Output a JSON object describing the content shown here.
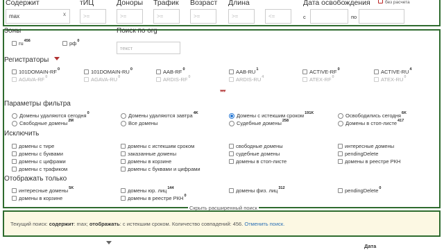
{
  "filters": {
    "content_label": "Содержит",
    "content_value": "max",
    "content_clear": "x",
    "tic_label": "тИЦ",
    "tic_placeholder": ">=",
    "donors_label": "Доноры",
    "donors_placeholder": ">=",
    "traffic_label": "Трафик",
    "traffic_placeholder": ">=",
    "age_label": "Возраст",
    "age_placeholder": ">=",
    "length_label": "Длина",
    "length_min_placeholder": ">=",
    "length_max_placeholder": "<=",
    "release_label": "Дата освобождения",
    "release_from": "с",
    "release_to": "по",
    "no_calc_label": "без расчета"
  },
  "zones": {
    "title": "Зоны",
    "items": [
      {
        "label": "ru",
        "count": "456"
      },
      {
        "label": "рф",
        "count": "0"
      }
    ]
  },
  "org_search": {
    "title": "Поиск по org",
    "placeholder": "текст"
  },
  "registrars": {
    "title": "Регистраторы",
    "items": [
      {
        "label": "101DOMAIN-RF",
        "count": "0"
      },
      {
        "label": "101DOMAIN-RU",
        "count": "0"
      },
      {
        "label": "AAB-RF",
        "count": "0"
      },
      {
        "label": "AAB-RU",
        "count": "1"
      },
      {
        "label": "ACTIVE-RF",
        "count": "0"
      },
      {
        "label": "ACTIVE-RU",
        "count": "4"
      },
      {
        "label": "AGAVA-RF",
        "count": "0"
      },
      {
        "label": "AGAVA-RU",
        "count": "0"
      },
      {
        "label": "ARDIS-RF",
        "count": "0"
      },
      {
        "label": "ARDIS-RU",
        "count": "4"
      },
      {
        "label": "ATEX-RF",
        "count": "0"
      },
      {
        "label": "ATEX-RU",
        "count": "0"
      }
    ],
    "more": "▾▾▾"
  },
  "filter_params": {
    "title": "Параметры фильтра",
    "items": [
      {
        "label": "Домены удаляются сегодня",
        "count": "0"
      },
      {
        "label": "Домены удаляются завтра",
        "count": "4K"
      },
      {
        "label": "Домены с истекшим сроком",
        "count": "191K"
      },
      {
        "label": "Освободились сегодня",
        "count": "6K"
      },
      {
        "label": "Свободные домены",
        "count": "2M"
      },
      {
        "label": "Все домены",
        "count": ""
      },
      {
        "label": "Судебные домены",
        "count": "258"
      },
      {
        "label": "Домены в стоп-листе",
        "count": "417"
      }
    ]
  },
  "exclude": {
    "title": "Исключить",
    "items": [
      "домены с тире",
      "домены с истекшим сроком",
      "свободные домены",
      "интересные домены",
      "домены с буквами",
      "заказанные домены",
      "судебные домены",
      "pendingDelete",
      "домены с цифрами",
      "домены в корзине",
      "домены в стоп-листе",
      "домены в реестре РКН",
      "домены с трафиком",
      "домены с буквами и цифрами"
    ]
  },
  "show_only": {
    "title": "Отображать только",
    "items": [
      {
        "label": "интересные домены",
        "count": "5K"
      },
      {
        "label": "домены юр. лиц",
        "count": "144"
      },
      {
        "label": "домены физ. лиц",
        "count": "312"
      },
      {
        "label": "pendingDelete",
        "count": "0"
      },
      {
        "label": "домены в корзине",
        "count": ""
      },
      {
        "label": "домены в реестре РКН",
        "count": "0"
      }
    ]
  },
  "collapse_link": "Скрыть расширенный поиск",
  "current_search": {
    "prefix": "Текущий поиск:",
    "contains_label": "содержит",
    "contains_value": ": max;",
    "show_label": "отображать",
    "show_value": ": с истекшим сроком. Количество совпадений: 456.",
    "cancel_link": "Отменить поиск."
  },
  "table_header": {
    "date_label": "Дата"
  },
  "colors": {
    "frame_green": "#2e6b2e",
    "info_bg": "#fcf8e3",
    "link_blue": "#2a6fb5",
    "accent_red": "#b03030"
  }
}
